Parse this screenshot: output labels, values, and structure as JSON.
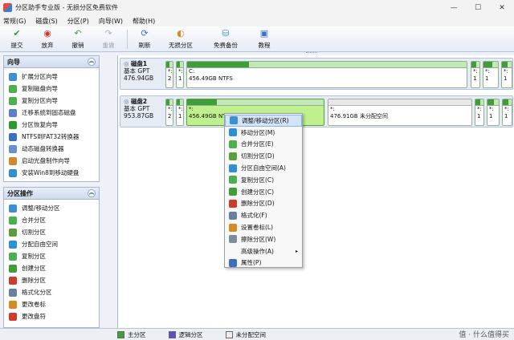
{
  "window": {
    "title": "分区助手专业版 - 无损分区免费软件",
    "controls": [
      "—",
      "☐",
      "✕"
    ]
  },
  "menu": [
    "常规(G)",
    "磁盘(S)",
    "分区(P)",
    "向导(W)",
    "帮助(H)"
  ],
  "toolbar": [
    {
      "label": "提交",
      "icon": "check-icon",
      "color": "#2e9a2e",
      "enabled": true
    },
    {
      "label": "放弃",
      "icon": "discard-icon",
      "color": "#d03a2a",
      "enabled": true
    },
    {
      "label": "撤销",
      "icon": "undo-icon",
      "color": "#3f9e3a",
      "enabled": true
    },
    {
      "label": "重做",
      "icon": "redo-icon",
      "color": "#aab4bf",
      "enabled": false
    },
    {
      "label": "刷新",
      "icon": "refresh-icon",
      "color": "#3a6fc4",
      "enabled": true
    },
    {
      "label": "无损分区",
      "icon": "partition-icon",
      "color": "#d88a22",
      "enabled": true
    },
    {
      "label": "免费备份",
      "icon": "backup-icon",
      "color": "#2e8fd6",
      "enabled": true
    },
    {
      "label": "教程",
      "icon": "tutorial-icon",
      "color": "#3a6fc4",
      "enabled": true
    }
  ],
  "sidebar": {
    "wizard": {
      "title": "向导",
      "items": [
        {
          "label": "扩展分区向导",
          "color": "#3a8fd8"
        },
        {
          "label": "复制磁盘向导",
          "color": "#4caf50"
        },
        {
          "label": "复制分区向导",
          "color": "#4caf50"
        },
        {
          "label": "迁移系统到固态磁盘",
          "color": "#5b7fd0"
        },
        {
          "label": "分区恢复向导",
          "color": "#2e9a2e"
        },
        {
          "label": "NTFS到FAT32转换器",
          "color": "#3a6fc4"
        },
        {
          "label": "动态磁盘转换器",
          "color": "#6a8fd0"
        },
        {
          "label": "启动光盘制作向导",
          "color": "#d08a2a"
        },
        {
          "label": "安装Win8到移动硬盘",
          "color": "#2e8fd6"
        }
      ]
    },
    "ops": {
      "title": "分区操作",
      "items": [
        {
          "label": "调整/移动分区",
          "color": "#3a8fd8"
        },
        {
          "label": "合并分区",
          "color": "#4caf50"
        },
        {
          "label": "切割分区",
          "color": "#5b9e3c"
        },
        {
          "label": "分配自由空间",
          "color": "#2e8fd6"
        },
        {
          "label": "复制分区",
          "color": "#4caf50"
        },
        {
          "label": "创建分区",
          "color": "#3f9e3a"
        },
        {
          "label": "删除分区",
          "color": "#d03a2a"
        },
        {
          "label": "格式化分区",
          "color": "#6a7fa0"
        },
        {
          "label": "更改卷标",
          "color": "#d88a22"
        },
        {
          "label": "更改盘符",
          "color": "#d03a2a"
        }
      ]
    }
  },
  "disks": [
    {
      "name": "磁盘1",
      "type": "基本 GPT",
      "size": "476.94GB",
      "parts": [
        {
          "label": "*:",
          "detail": "2",
          "fill": 0.5
        },
        {
          "label": "*:",
          "detail": "1",
          "fill": 0.5
        },
        {
          "label": "C:",
          "detail": "456.49GB NTFS",
          "fill": 0.22
        },
        {
          "label": "*:",
          "detail": "1",
          "fill": 0.6
        },
        {
          "label": "*:",
          "detail": "1",
          "fill": 0.6
        },
        {
          "label": "*:",
          "detail": "1",
          "fill": 0.6
        }
      ]
    },
    {
      "name": "磁盘2",
      "type": "基本 GPT",
      "size": "953.87GB",
      "parts": [
        {
          "label": "*:",
          "detail": "2",
          "fill": 0.5
        },
        {
          "label": "*:",
          "detail": "1",
          "fill": 0.5
        },
        {
          "label": "*:",
          "detail": "456.49GB NTFS",
          "fill": 0.22
        },
        {
          "label": "*:",
          "detail": "476.91GB 未分配空间",
          "fill": 0
        },
        {
          "label": "*:",
          "detail": "1",
          "fill": 0.6
        },
        {
          "label": "*:",
          "detail": "1",
          "fill": 0.6
        },
        {
          "label": "*:",
          "detail": "1",
          "fill": 0.6
        }
      ]
    }
  ],
  "context_menu": [
    {
      "label": "调整/移动分区(R)",
      "color": "#3a8fd8"
    },
    {
      "label": "移动分区(M)",
      "color": "#2e8fd6"
    },
    {
      "label": "合并分区(E)",
      "color": "#4caf50"
    },
    {
      "label": "切割分区(D)",
      "color": "#5b9e3c"
    },
    {
      "label": "分区自由空间(A)",
      "color": "#2e8fd6"
    },
    {
      "label": "复制分区(C)",
      "color": "#4caf50"
    },
    {
      "label": "创建分区(C)",
      "color": "#3f9e3a"
    },
    {
      "label": "删除分区(D)",
      "color": "#d03a2a"
    },
    {
      "label": "格式化(F)",
      "color": "#6a7fa0"
    },
    {
      "label": "设置卷标(L)",
      "color": "#d88a22"
    },
    {
      "label": "擦除分区(W)",
      "color": "#7a8aa0"
    },
    {
      "label": "高级操作(A)",
      "color": "",
      "submenu": "▸"
    },
    {
      "label": "属性(P)",
      "color": "#3a6fc4"
    }
  ],
  "legend": [
    {
      "label": "主分区",
      "color": "#3f9e3a"
    },
    {
      "label": "逻辑分区",
      "color": "#5b4fd0"
    },
    {
      "label": "未分配空间",
      "color": "#f2f0e6"
    }
  ],
  "watermark": "值 · 什么值得买"
}
